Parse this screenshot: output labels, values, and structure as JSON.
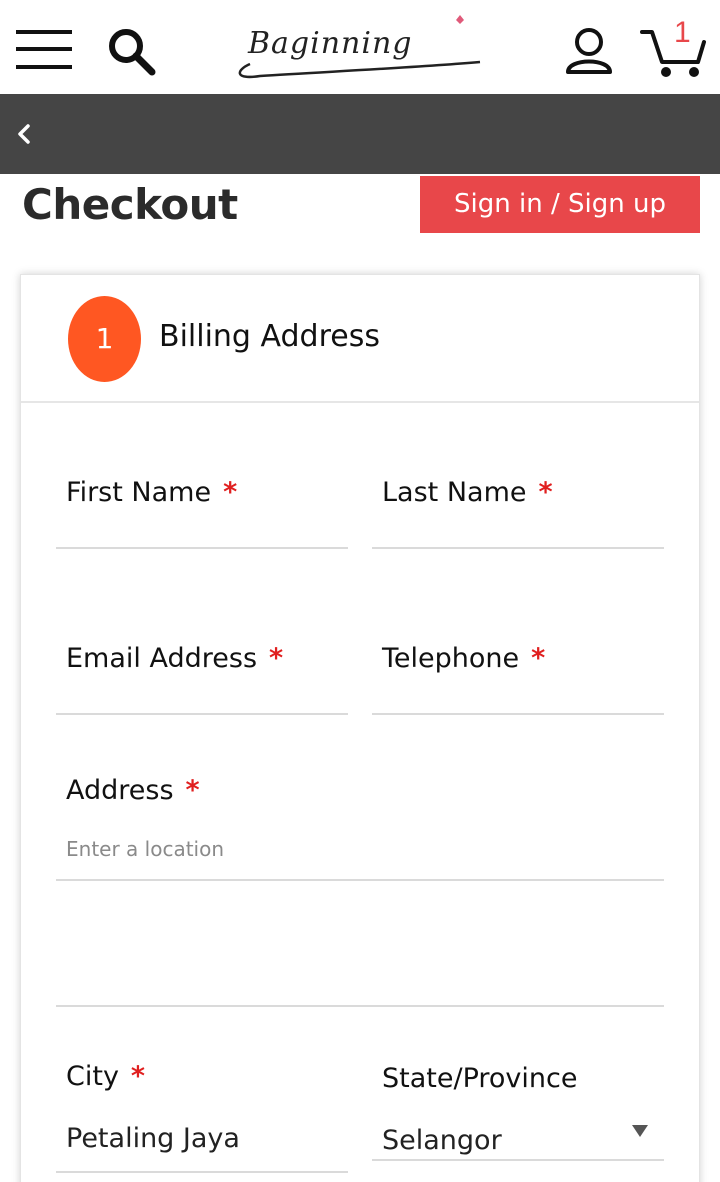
{
  "header": {
    "logo_text": "Baginning",
    "cart_count": "1"
  },
  "page": {
    "title": "Checkout",
    "signin_label": "Sign in / Sign up"
  },
  "billing": {
    "step_number": "1",
    "section_title": "Billing Address",
    "required_mark": "*",
    "first_name_label": "First Name",
    "last_name_label": "Last Name",
    "email_label": "Email Address",
    "telephone_label": "Telephone",
    "address_label": "Address",
    "address_placeholder": "Enter a location",
    "city_label": "City",
    "city_value": "Petaling Jaya",
    "state_label": "State/Province",
    "state_value": "Selangor"
  },
  "colors": {
    "accent": "#e8474a",
    "step_badge": "#ff5722",
    "navbar": "#454545",
    "required": "#e01f1f"
  }
}
